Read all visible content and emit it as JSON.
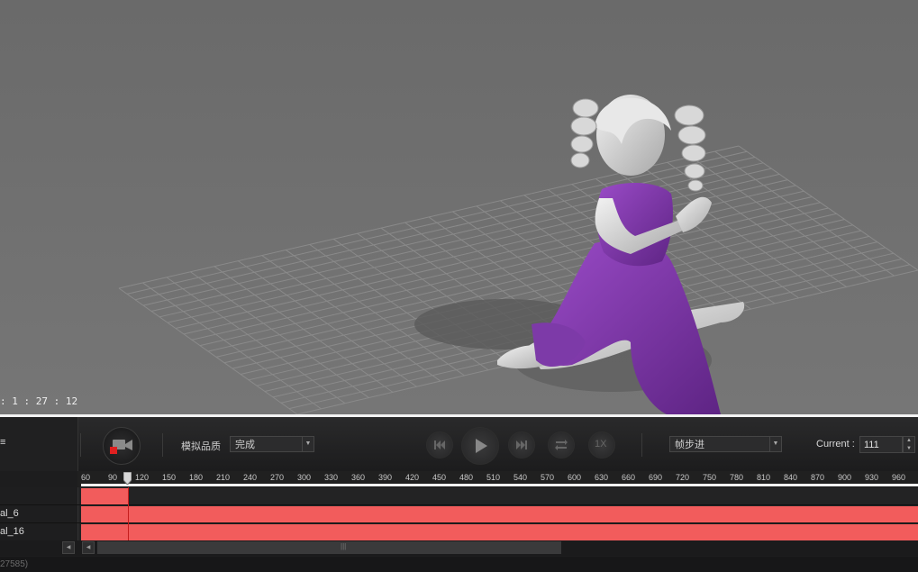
{
  "viewport": {
    "timecode": ": 1 : 27 : 12"
  },
  "toolbar": {
    "left_header": "≡",
    "record_button": "record-camera",
    "quality_label": "模拟品质",
    "quality_value": "完成",
    "rewind_icon": "skip-to-start-icon",
    "play_icon": "play-icon",
    "forward_icon": "skip-to-end-icon",
    "loop_icon": "loop-icon",
    "speed_label": "1X",
    "step_mode_value": "帧步进",
    "current_label": "Current :",
    "current_value": "111"
  },
  "ruler": {
    "ticks": [
      "60",
      "90",
      "120",
      "150",
      "180",
      "210",
      "240",
      "270",
      "300",
      "330",
      "360",
      "390",
      "420",
      "450",
      "480",
      "510",
      "540",
      "570",
      "600",
      "630",
      "660",
      "690",
      "720",
      "750",
      "780",
      "810",
      "840",
      "870",
      "900",
      "930",
      "960"
    ],
    "current_frame": 111
  },
  "tracks": [
    {
      "name": ""
    },
    {
      "name": "al_6"
    },
    {
      "name": "al_16"
    }
  ],
  "status": {
    "text": "27585)"
  },
  "colors": {
    "track_bar": "#f25c5c",
    "dress": "#8a3fb5",
    "record_red": "#e02020"
  }
}
